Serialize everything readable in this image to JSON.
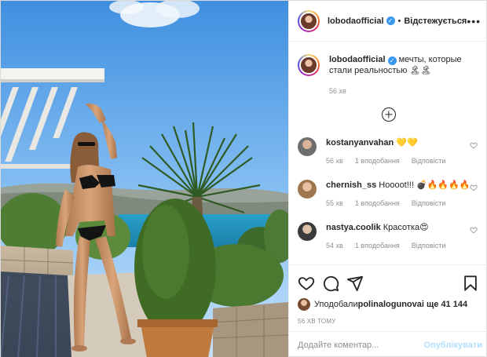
{
  "post": {
    "author": "lobodaofficial",
    "verified_icon": "verified-badge-icon",
    "follow_status": "Відстежується",
    "more_icon": "more-options-icon",
    "caption": "мечты, которые стали реальностью 🏝🏝",
    "caption_time": "56 хв"
  },
  "comments": [
    {
      "user": "kostanyanvahan",
      "text": "💛💛",
      "time": "56 хв",
      "likes": "1 вподобання",
      "reply": "Відповісти"
    },
    {
      "user": "chernish_ss",
      "text": "Hoooot!!! 💣🔥🔥🔥🔥",
      "time": "55 хв",
      "likes": "1 вподобання",
      "reply": "Відповісти"
    },
    {
      "user": "nastya.coolik",
      "text": "Красотка😍",
      "time": "54 хв",
      "likes": "1 вподобання",
      "reply": "Відповісти"
    }
  ],
  "actions": {
    "like_icon": "heart-icon",
    "comment_icon": "comment-icon",
    "share_icon": "share-icon",
    "save_icon": "bookmark-icon"
  },
  "likes": {
    "prefix": "Уподобали ",
    "user": "polinalogunova",
    "suffix": " і ще 41 144"
  },
  "posted": "56 ХВ ТОМУ",
  "add_comment": {
    "placeholder": "Додайте коментар...",
    "publish": "Опублікувати"
  },
  "colors": {
    "accent": "#3897f0",
    "publish_disabled": "#b2dffc",
    "secondary_text": "#8e8e8e"
  }
}
